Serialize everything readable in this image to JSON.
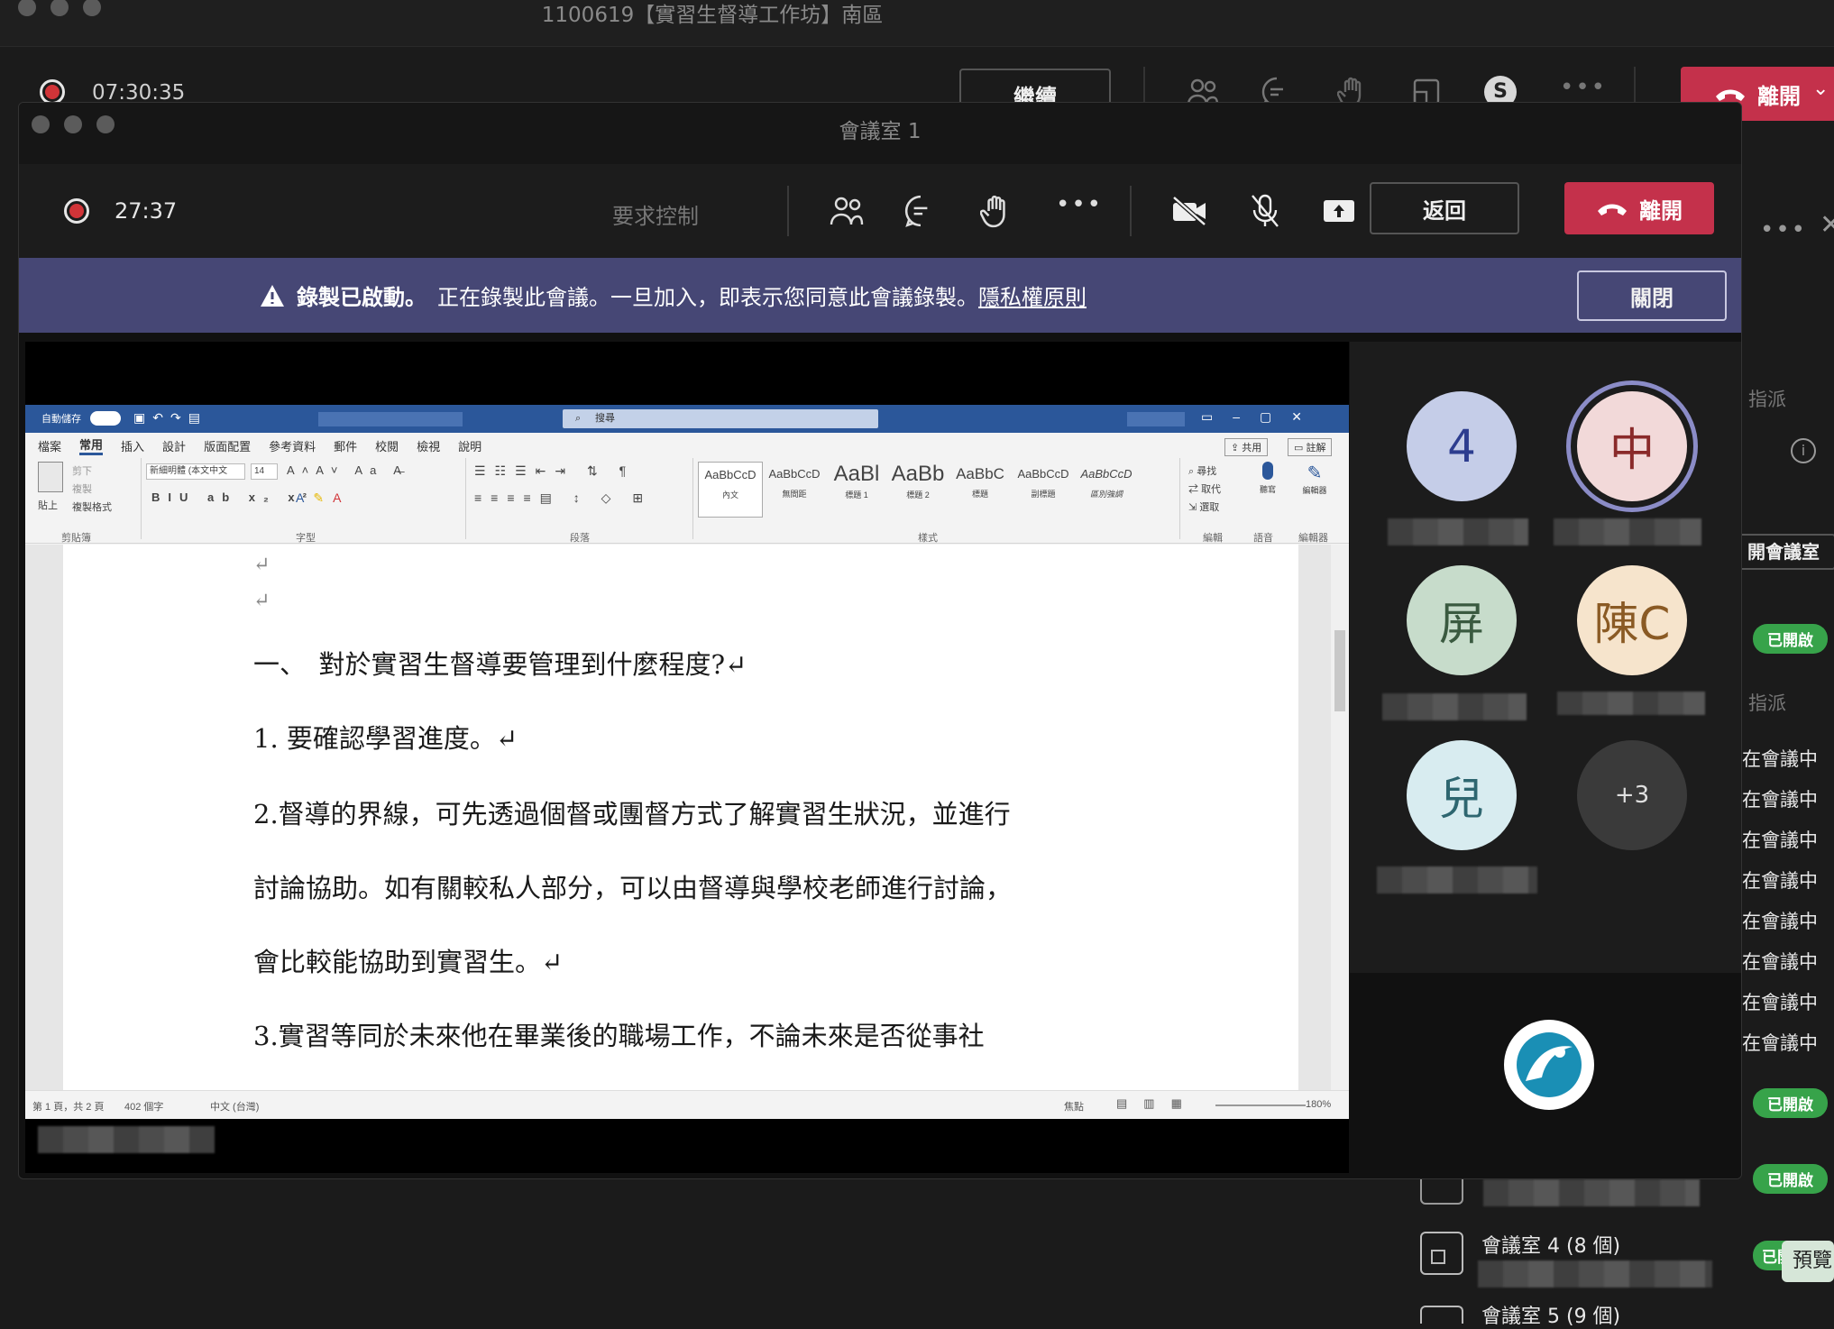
{
  "outer": {
    "title": "1100619【實習生督導工作坊】南區",
    "timer": "07:30:35",
    "resume_label": "繼續",
    "leave_label": "離開"
  },
  "inner": {
    "title": "會議室 1",
    "timer": "27:37",
    "request_control_label": "要求控制",
    "back_label": "返回",
    "leave_label": "離開"
  },
  "banner": {
    "headline": "錄製已啟動。",
    "message": "正在錄製此會議。一旦加入，即表示您同意此會議錄製。",
    "link": "隱私權原則",
    "close_label": "關閉"
  },
  "word": {
    "autosave": "自動儲存",
    "search_placeholder": "搜尋",
    "tabs": [
      "檔案",
      "常用",
      "插入",
      "設計",
      "版面配置",
      "參考資料",
      "郵件",
      "校閱",
      "檢視",
      "說明"
    ],
    "share_label": "共用",
    "comment_label": "註解",
    "font_name": "新細明體 (本文中文",
    "font_size": "14",
    "clipboard": {
      "paste": "貼上",
      "cut": "剪下",
      "copy": "複製",
      "format_painter": "複製格式",
      "group": "剪貼簿"
    },
    "group_labels": {
      "font": "字型",
      "paragraph": "段落",
      "styles": "樣式",
      "editing": "編輯",
      "voice": "語音",
      "editor": "編輯器"
    },
    "styles": [
      {
        "sample": "AaBbCcD",
        "name": "內文"
      },
      {
        "sample": "AaBbCcD",
        "name": "無間距"
      },
      {
        "sample": "AaBl",
        "name": "標題 1"
      },
      {
        "sample": "AaBb",
        "name": "標題 2"
      },
      {
        "sample": "AaBbC",
        "name": "標題"
      },
      {
        "sample": "AaBbCcD",
        "name": "副標題"
      },
      {
        "sample": "AaBbCcD",
        "name": "區別強調"
      }
    ],
    "editing": {
      "find": "尋找",
      "replace": "取代",
      "select": "選取"
    },
    "voice": {
      "dictate": "聽寫"
    },
    "editor": {
      "editor": "編輯器"
    },
    "doc": {
      "heading": "一、　對於實習生督導要管理到什麼程度?↵",
      "p1": "1.  要確認學習進度。↵",
      "p2a": "2.督導的界線，可先透過個督或團督方式了解實習生狀況，並進行",
      "p2b": "討論協助。如有關較私人部分，可以由督導與學校老師進行討論，",
      "p2c": "會比較能協助到實習生。↵",
      "p3": "3.實習等同於未來他在畢業後的職場工作，不論未來是否從事社"
    },
    "status": {
      "page": "第 1 頁，共 2 頁",
      "words": "402 個字",
      "lang": "中文 (台灣)",
      "focus": "焦點",
      "zoom": "180%"
    }
  },
  "participants": [
    {
      "initials": "4",
      "bg": "#c5cde8",
      "fg": "#2d3d8f"
    },
    {
      "initials": "中",
      "bg": "#f2d9d9",
      "fg": "#8a2a2a",
      "speaking": true
    },
    {
      "initials": "屏",
      "bg": "#c7dccb",
      "fg": "#3a5a40"
    },
    {
      "initials": "陳C",
      "bg": "#f6e4cc",
      "fg": "#8a5a24"
    },
    {
      "initials": "兒",
      "bg": "#d8ecf0",
      "fg": "#2e6670"
    },
    {
      "initials": "+3",
      "bg": "#3a3a3a",
      "fg": "#e0e0e0"
    }
  ],
  "sidebar": {
    "assign1": "指派",
    "room_btn": "開會議室",
    "opened": "已開啟",
    "assign2": "指派",
    "in_meeting": [
      "在會議中",
      "在會議中",
      "在會議中",
      "在會議中",
      "在會議中",
      "在會議中",
      "在會議中",
      "在會議中"
    ],
    "room4": "會議室 4 (8 個)",
    "room5": "會議室 5 (9 個)",
    "preview": "預覽"
  }
}
